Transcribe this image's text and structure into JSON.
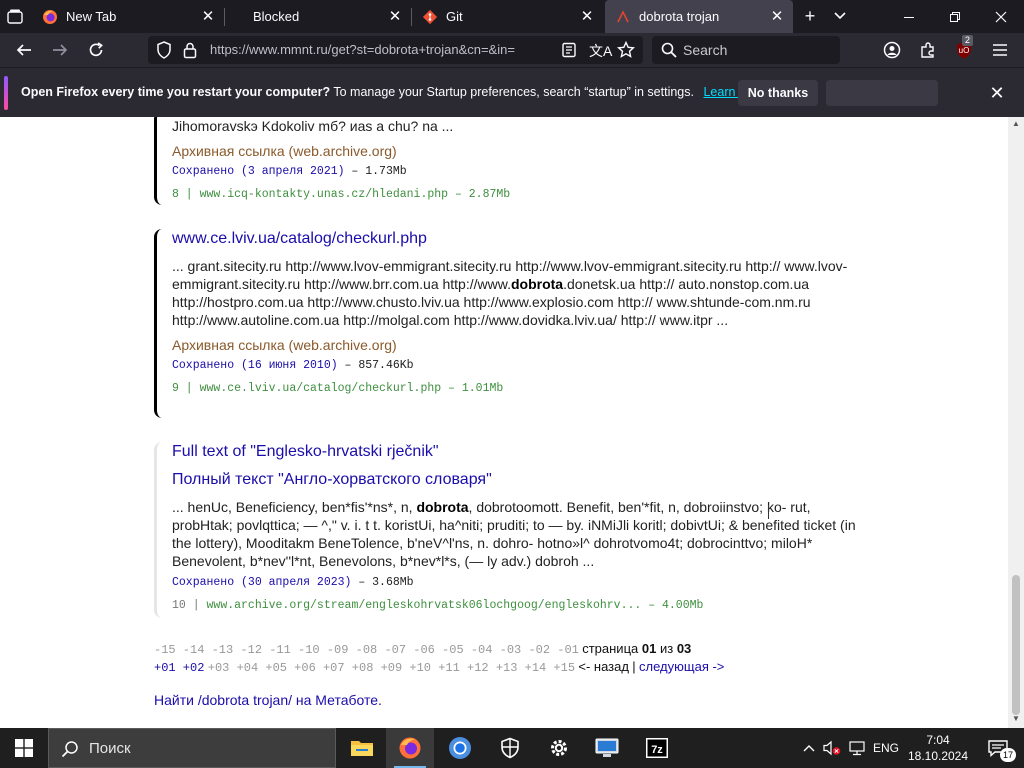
{
  "browser": {
    "tabs": [
      {
        "title": "New Tab",
        "favicon": "firefox-icon",
        "active": false
      },
      {
        "title": "Blocked",
        "favicon": "none",
        "active": false
      },
      {
        "title": "Git",
        "favicon": "git-icon",
        "active": false
      },
      {
        "title": "dobrota trojan",
        "favicon": "mmnt-icon",
        "active": true
      }
    ],
    "url": "https://www.mmnt.ru/get?st=dobrota+trojan&cn=&in=",
    "search_placeholder": "Search",
    "extension_badge": "2"
  },
  "notification": {
    "bold": "Open Firefox every time you restart your computer?",
    "text": "To manage your Startup preferences, search “startup” in settings.",
    "link": "Learn more",
    "button_no_thanks": "No thanks"
  },
  "results": [
    {
      "snippet_tail": "Jihomoravskэ Kdokoliv mб? иas a chu? na ...",
      "archive": "Архивная ссылка (web.archive.org)",
      "saved": "Сохранено (3 апреля 2021)",
      "size": " – 1.73Mb",
      "num": "8 | ",
      "link": "www.icq-kontakty.unas.cz/hledani.php",
      "link_size": " – 2.87Mb"
    },
    {
      "title": "www.ce.lviv.ua/catalog/checkurl.php",
      "snippet_a": "... grant.sitecity.ru http://www.lvov-emmigrant.sitecity.ru http://www.lvov-emmigrant.sitecity.ru http:// www.lvov-emmigrant.sitecity.ru http://www.brr.com.ua http://www.",
      "snippet_bold": "dobrota",
      "snippet_b": ".donetsk.ua http:// auto.nonstop.com.ua http://hostpro.com.ua http://www.chusto.lviv.ua http://www.explosio.com http:// www.shtunde-com.nm.ru http://www.autoline.com.ua http://molgal.com http://www.dovidka.lviv.ua/ http:// www.itpr ...",
      "archive": "Архивная ссылка (web.archive.org)",
      "saved": "Сохранено (16 июня 2010)",
      "size": " – 857.46Kb",
      "num": "9 | ",
      "link": "www.ce.lviv.ua/catalog/checkurl.php",
      "link_size": " – 1.01Mb"
    },
    {
      "title": "Full text of \"Englesko-hrvatski rječnik\"",
      "title_ru": "Полный текст \"Англо-хорватского словаря\"",
      "snippet_a": "... henUc, Beneficiency, ben*fis'*ns*, n, ",
      "snippet_bold": "dobrota",
      "snippet_b": ", dobrotoomott. Benefit, ben'*fit, n, dobroiinstvo; ko- rut, probHtak; povlqttica; — ^,\" v. i. t t. koristUi, ha^niti; pruditi; to — by. iNMiJli koritl; dobivtUi; & benefited ticket (in the lottery), Mooditakm BeneTolence, b'neV^l'ns, n. dohro- hotno»l^ dohrotvomo4t; dobrocinttvo; miloH* Benevolent, b*nev''l*nt, Benevolons, b*nev*l*s, (— ly adv.) dobroh ...",
      "saved": "Сохранено (30 апреля 2023)",
      "size": " – 3.68Mb",
      "num": "10 | ",
      "link": "www.archive.org/stream/engleskohrvatsk06lochgoog/engleskohrv...",
      "link_size": " – 4.00Mb"
    }
  ],
  "pager": {
    "prev_nums": "-15 -14 -13 -12 -11 -10 -09 -08 -07 -06 -05 -04 -03 -02 -01",
    "page_label": "страница",
    "current_page": "01",
    "of_label": "из",
    "total_pages": "03",
    "next_near": "+01 +02",
    "next_far": "+03 +04 +05 +06 +07 +08 +09 +10 +11 +12 +13 +14 +15",
    "back": "<- назад",
    "separator": "|",
    "next": "следующая ->"
  },
  "metabot_link": "Найти /dobrota trojan/ на Метаботе.",
  "taskbar": {
    "search_placeholder": "Поиск",
    "apps": [
      "file-explorer-icon",
      "firefox-icon",
      "chromium-icon",
      "security-shield-icon",
      "settings-gear-icon",
      "remote-desktop-icon",
      "7zip-icon"
    ],
    "language": "ENG",
    "time": "7:04",
    "date": "18.10.2024",
    "notification_count": "17"
  },
  "colors": {
    "link_blue": "#1a0dab",
    "archive_brown": "#8a5a2b",
    "green_url": "#3f8f3f",
    "firefox_dark": "#1c1b22",
    "firefox_toolbar": "#2b2a33",
    "learn_more": "#00ddff"
  }
}
